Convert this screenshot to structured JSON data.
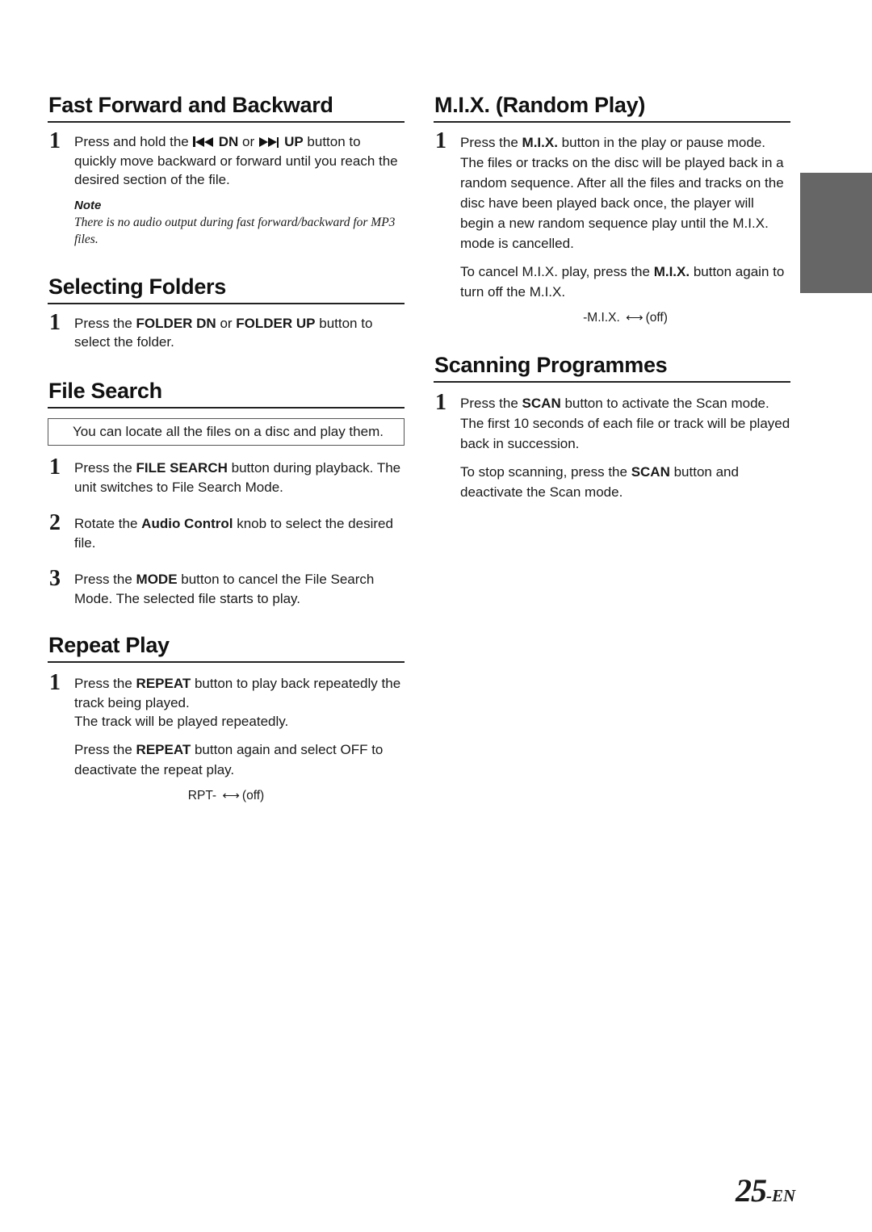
{
  "page": {
    "number": "25",
    "suffix": "-EN",
    "side_tab_color": "#666666"
  },
  "left": {
    "fast_forward": {
      "title": "Fast Forward and Backward",
      "steps": [
        {
          "num": "1",
          "pre": "Press and hold the ",
          "dn_label": "DN",
          "mid": " or ",
          "up_label": "UP",
          "post": " button to quickly move backward or forward until you reach the desired section of the file.",
          "icons": [
            "previous-track-icon",
            "next-track-icon"
          ]
        }
      ],
      "note_label": "Note",
      "note_text": "There is no audio output during fast forward/backward for MP3 files."
    },
    "selecting_folders": {
      "title": "Selecting Folders",
      "steps": [
        {
          "num": "1",
          "pre": "Press the ",
          "b1": "FOLDER DN",
          "mid": " or ",
          "b2": "FOLDER UP",
          "post": " button to select the folder."
        }
      ]
    },
    "file_search": {
      "title": "File Search",
      "info": "You can locate all the files on a disc and play them.",
      "steps": [
        {
          "num": "1",
          "pre": "Press the ",
          "bold": "FILE SEARCH",
          "post": " button during playback. The unit switches to File Search Mode."
        },
        {
          "num": "2",
          "pre": "Rotate the ",
          "bold": "Audio Control",
          "post": " knob to select the desired file."
        },
        {
          "num": "3",
          "pre": "Press the ",
          "bold": "MODE",
          "post": " button to cancel the File Search Mode. The selected file starts to play."
        }
      ]
    },
    "repeat_play": {
      "title": "Repeat Play",
      "steps": [
        {
          "num": "1",
          "pre": "Press the ",
          "bold": "REPEAT",
          "post": " button to play back repeatedly the track being played.",
          "line2": "The track will be played repeatedly."
        }
      ],
      "extra_pre": "Press the ",
      "extra_bold": "REPEAT",
      "extra_post": " button again and select OFF to deactivate the repeat play.",
      "cycle_from": "RPT-",
      "cycle_arrow": "⟷",
      "cycle_to": "(off)"
    }
  },
  "right": {
    "mix": {
      "title": "M.I.X. (Random Play)",
      "steps": [
        {
          "num": "1",
          "pre": "Press the ",
          "bold": "M.I.X.",
          "post": " button in the play or pause mode. The files or tracks on the disc will be played back in a random sequence. After all the files and tracks on the disc have been played back once, the player will begin a new random sequence play until the M.I.X. mode is cancelled."
        }
      ],
      "extra_pre": "To cancel M.I.X. play, press the ",
      "extra_bold": "M.I.X.",
      "extra_post": " button again to turn off the M.I.X.",
      "cycle_from": "-M.I.X.",
      "cycle_arrow": "⟷",
      "cycle_to": "(off)"
    },
    "scanning": {
      "title": "Scanning Programmes",
      "steps": [
        {
          "num": "1",
          "pre": "Press the ",
          "bold": "SCAN",
          "post": " button to activate the Scan mode.",
          "line2": "The first 10 seconds of each file or track will be played back in succession."
        }
      ],
      "extra_pre": "To stop scanning, press the ",
      "extra_bold": "SCAN",
      "extra_post": " button and deactivate the Scan mode."
    }
  }
}
